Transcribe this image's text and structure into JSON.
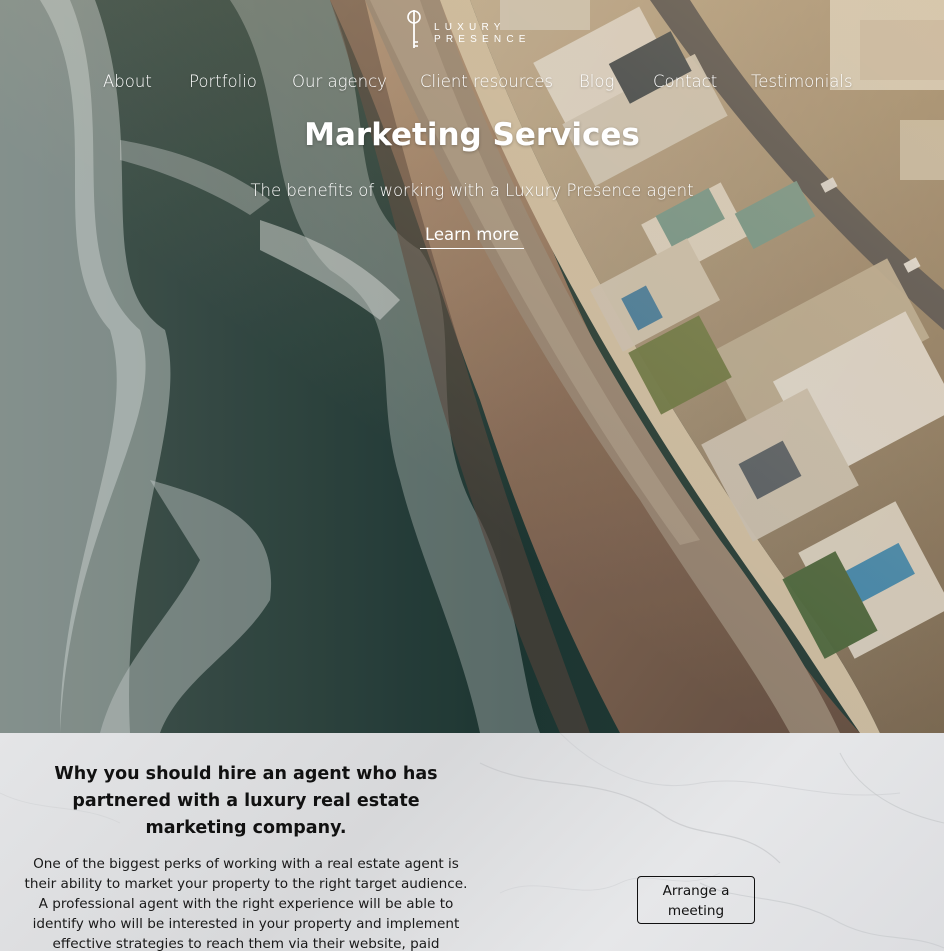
{
  "brand": {
    "logo_line1": "LUXURY",
    "logo_line2": "PRESENCE"
  },
  "nav": {
    "items": [
      {
        "label": "About"
      },
      {
        "label": "Portfolio"
      },
      {
        "label": "Our agency"
      },
      {
        "label": "Client resources"
      },
      {
        "label": "Blog"
      },
      {
        "label": "Contact"
      },
      {
        "label": "Testimonials"
      }
    ]
  },
  "hero": {
    "title": "Marketing Services",
    "subtitle": "The benefits of working with a Luxury Presence agent",
    "cta_label": "Learn more",
    "background": "aerial-coastline-image"
  },
  "why": {
    "title": "Why you should hire an agent who has partnered with a luxury real estate marketing company.",
    "body": "One of the biggest perks of working with a real estate agent is their ability to market your property to the right target audience. A professional agent with the right experience will be able to identify who will be interested in your property and implement effective strategies to reach them via their website, paid advertising, social",
    "meeting_button": "Arrange a meeting"
  },
  "colors": {
    "text_light": "#ffffff",
    "text_dark": "#111111",
    "section_bg": "#dfe0e2"
  }
}
